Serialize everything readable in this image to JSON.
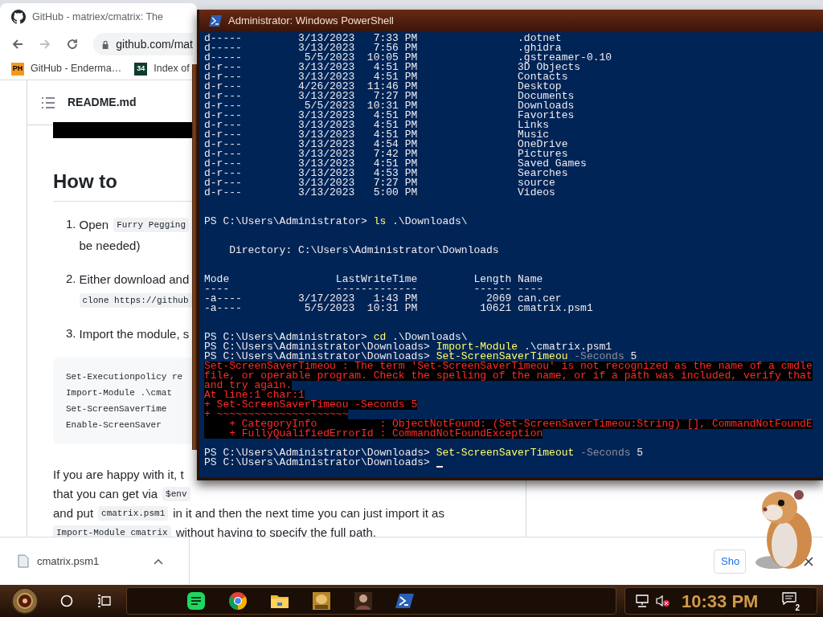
{
  "browser": {
    "tab": {
      "title": "GitHub - matriex/cmatrix: The"
    },
    "address": {
      "url": "github.com/mat"
    },
    "bookmarks": [
      {
        "badge": "PH",
        "label": "GitHub - Enderma…",
        "kind": "ph"
      },
      {
        "badge": "34",
        "label": "Index of",
        "kind": "grid"
      }
    ],
    "readme": {
      "file": "README.md",
      "heading": "How to",
      "steps": [
        {
          "number": "1.",
          "lines": [
            [
              {
                "text": "Open",
                "kind": "prose"
              },
              {
                "text": "Furry Pegging",
                "kind": "code"
              }
            ],
            [
              {
                "text": "be needed)",
                "kind": "prose"
              }
            ]
          ]
        },
        {
          "number": "2.",
          "lines": [
            [
              {
                "text": "Either download and",
                "kind": "prose"
              }
            ],
            [
              {
                "text": "clone https://github",
                "kind": "code"
              }
            ]
          ]
        },
        {
          "number": "3.",
          "lines": [
            [
              {
                "text": "Import the module, s",
                "kind": "prose"
              }
            ]
          ]
        }
      ],
      "code_lines": [
        "Set-Executionpolicy re",
        "Import-Module .\\cmat",
        "Set-ScreenSaverTime",
        "Enable-ScreenSaver"
      ],
      "paragraph_lines": [
        [
          {
            "text": "If you are happy with it, t",
            "kind": "prose"
          }
        ],
        [
          {
            "text": "that you can get via",
            "kind": "prose"
          },
          {
            "text": "$env",
            "kind": "code"
          }
        ],
        [
          {
            "text": "and put",
            "kind": "prose"
          },
          {
            "text": "cmatrix.psm1",
            "kind": "code"
          },
          {
            "text": "in it and then the next time you can just import it as",
            "kind": "prose"
          }
        ],
        [
          {
            "text": "Import-Module cmatrix",
            "kind": "code"
          },
          {
            "text": "without having to specify the full path.",
            "kind": "prose"
          }
        ]
      ]
    },
    "download": {
      "file": "cmatrix.psm1",
      "show_button": "Sho"
    }
  },
  "powershell": {
    "title": "Administrator: Windows PowerShell",
    "cursor_visible": true,
    "lines": [
      {
        "kind": "text",
        "segments": [
          {
            "text": "d-----         3/13/2023   7:33 PM                .dotnet",
            "kind": "output"
          }
        ]
      },
      {
        "kind": "text",
        "segments": [
          {
            "text": "d-----         3/13/2023   7:56 PM                .ghidra",
            "kind": "output"
          }
        ]
      },
      {
        "kind": "text",
        "segments": [
          {
            "text": "d-----          5/5/2023  10:05 PM                .gstreamer-0.10",
            "kind": "output"
          }
        ]
      },
      {
        "kind": "text",
        "segments": [
          {
            "text": "d-r---         3/13/2023   4:51 PM                3D Objects",
            "kind": "output"
          }
        ]
      },
      {
        "kind": "text",
        "segments": [
          {
            "text": "d-r---         3/13/2023   4:51 PM                Contacts",
            "kind": "output"
          }
        ]
      },
      {
        "kind": "text",
        "segments": [
          {
            "text": "d-r---         4/26/2023  11:46 PM                Desktop",
            "kind": "output"
          }
        ]
      },
      {
        "kind": "text",
        "segments": [
          {
            "text": "d-r---         3/13/2023   7:27 PM                Documents",
            "kind": "output"
          }
        ]
      },
      {
        "kind": "text",
        "segments": [
          {
            "text": "d-r---          5/5/2023  10:31 PM                Downloads",
            "kind": "output"
          }
        ]
      },
      {
        "kind": "text",
        "segments": [
          {
            "text": "d-r---         3/13/2023   4:51 PM                Favorites",
            "kind": "output"
          }
        ]
      },
      {
        "kind": "text",
        "segments": [
          {
            "text": "d-r---         3/13/2023   4:51 PM                Links",
            "kind": "output"
          }
        ]
      },
      {
        "kind": "text",
        "segments": [
          {
            "text": "d-r---         3/13/2023   4:51 PM                Music",
            "kind": "output"
          }
        ]
      },
      {
        "kind": "text",
        "segments": [
          {
            "text": "d-r---         3/13/2023   4:54 PM                OneDrive",
            "kind": "output"
          }
        ]
      },
      {
        "kind": "text",
        "segments": [
          {
            "text": "d-r---         3/13/2023   7:42 PM                Pictures",
            "kind": "output"
          }
        ]
      },
      {
        "kind": "text",
        "segments": [
          {
            "text": "d-r---         3/13/2023   4:51 PM                Saved Games",
            "kind": "output"
          }
        ]
      },
      {
        "kind": "text",
        "segments": [
          {
            "text": "d-r---         3/13/2023   4:53 PM                Searches",
            "kind": "output"
          }
        ]
      },
      {
        "kind": "text",
        "segments": [
          {
            "text": "d-r---         3/13/2023   7:27 PM                source",
            "kind": "output"
          }
        ]
      },
      {
        "kind": "text",
        "segments": [
          {
            "text": "d-r---         3/13/2023   5:00 PM                Videos",
            "kind": "output"
          }
        ]
      },
      {
        "kind": "blank"
      },
      {
        "kind": "blank"
      },
      {
        "kind": "text",
        "segments": [
          {
            "text": "PS C:\\Users\\Administrator> ",
            "kind": "output"
          },
          {
            "text": "ls",
            "kind": "command"
          },
          {
            "text": " .\\Downloads\\",
            "kind": "output"
          }
        ]
      },
      {
        "kind": "blank"
      },
      {
        "kind": "blank"
      },
      {
        "kind": "text",
        "segments": [
          {
            "text": "    Directory: C:\\Users\\Administrator\\Downloads",
            "kind": "output"
          }
        ]
      },
      {
        "kind": "blank"
      },
      {
        "kind": "blank"
      },
      {
        "kind": "text",
        "segments": [
          {
            "text": "Mode                 LastWriteTime         Length Name",
            "kind": "output"
          }
        ]
      },
      {
        "kind": "text",
        "segments": [
          {
            "text": "----                 -------------         ------ ----",
            "kind": "output"
          }
        ]
      },
      {
        "kind": "text",
        "segments": [
          {
            "text": "-a----         3/17/2023   1:43 PM           2069 can.cer",
            "kind": "output"
          }
        ]
      },
      {
        "kind": "text",
        "segments": [
          {
            "text": "-a----          5/5/2023  10:31 PM          10621 cmatrix.psm1",
            "kind": "output"
          }
        ]
      },
      {
        "kind": "blank"
      },
      {
        "kind": "blank"
      },
      {
        "kind": "text",
        "segments": [
          {
            "text": "PS C:\\Users\\Administrator> ",
            "kind": "output"
          },
          {
            "text": "cd",
            "kind": "command"
          },
          {
            "text": " .\\Downloads\\",
            "kind": "output"
          }
        ]
      },
      {
        "kind": "text",
        "segments": [
          {
            "text": "PS C:\\Users\\Administrator\\Downloads> ",
            "kind": "output"
          },
          {
            "text": "Import-Module",
            "kind": "command"
          },
          {
            "text": " .\\cmatrix.psm1",
            "kind": "output"
          }
        ]
      },
      {
        "kind": "text",
        "segments": [
          {
            "text": "PS C:\\Users\\Administrator\\Downloads> ",
            "kind": "output"
          },
          {
            "text": "Set-ScreenSaverTimeou",
            "kind": "command"
          },
          {
            "text": " -Seconds",
            "kind": "parameter"
          },
          {
            "text": " 5",
            "kind": "output"
          }
        ]
      },
      {
        "kind": "text",
        "segments": [
          {
            "text": "Set-ScreenSaverTimeou : The term 'Set-ScreenSaverTimeou' is not recognized as the name of a cmdle",
            "kind": "error"
          }
        ]
      },
      {
        "kind": "text",
        "segments": [
          {
            "text": "file, or operable program. Check the spelling of the name, or if a path was included, verify that",
            "kind": "error"
          }
        ]
      },
      {
        "kind": "text",
        "segments": [
          {
            "text": "and try again.",
            "kind": "error"
          }
        ]
      },
      {
        "kind": "text",
        "segments": [
          {
            "text": "At line:1 char:1",
            "kind": "error"
          }
        ]
      },
      {
        "kind": "text",
        "segments": [
          {
            "text": "+ Set-ScreenSaverTimeou -Seconds 5",
            "kind": "error"
          }
        ]
      },
      {
        "kind": "text",
        "segments": [
          {
            "text": "+ ~~~~~~~~~~~~~~~~~~~~~",
            "kind": "error"
          }
        ]
      },
      {
        "kind": "text",
        "segments": [
          {
            "text": "    + CategoryInfo          : ObjectNotFound: (Set-ScreenSaverTimeou:String) [], CommandNotFoundE",
            "kind": "error"
          }
        ]
      },
      {
        "kind": "text",
        "segments": [
          {
            "text": "    + FullyQualifiedErrorId : CommandNotFoundException",
            "kind": "error"
          }
        ]
      },
      {
        "kind": "blank"
      },
      {
        "kind": "text",
        "segments": [
          {
            "text": "PS C:\\Users\\Administrator\\Downloads> ",
            "kind": "output"
          },
          {
            "text": "Set-ScreenSaverTimeout",
            "kind": "command"
          },
          {
            "text": " -Seconds",
            "kind": "parameter"
          },
          {
            "text": " 5",
            "kind": "output"
          }
        ]
      },
      {
        "kind": "text",
        "segments": [
          {
            "text": "PS C:\\Users\\Administrator\\Downloads> ",
            "kind": "output"
          }
        ]
      }
    ]
  },
  "taskbar": {
    "apps": [
      {
        "kind": "notes"
      },
      {
        "kind": "chrome"
      },
      {
        "kind": "folder"
      },
      {
        "kind": "game"
      },
      {
        "kind": "portrait"
      },
      {
        "kind": "powershell"
      }
    ],
    "clock": "10:33 PM",
    "notifications": "2"
  }
}
